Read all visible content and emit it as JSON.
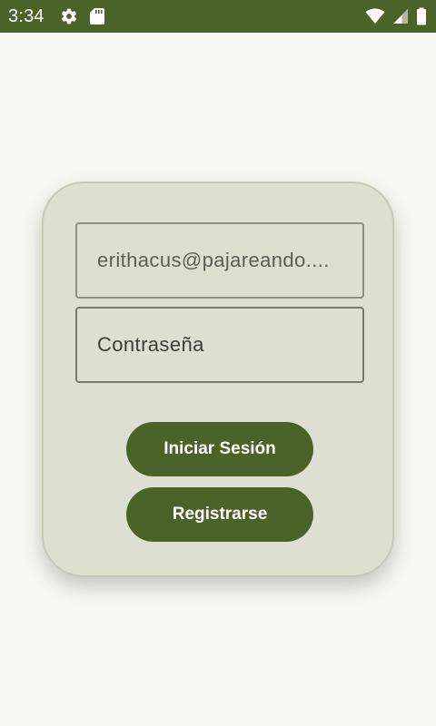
{
  "status_bar": {
    "time": "3:34",
    "bg_color": "#4b6329",
    "left_icons": [
      "gear-icon",
      "sd-card-icon"
    ],
    "right_icons": [
      "wifi-icon",
      "cell-signal-icon",
      "battery-icon"
    ]
  },
  "login_form": {
    "email": {
      "value": "erithacus@pajareando.com",
      "display": "erithacus@pajareando...."
    },
    "password": {
      "placeholder": "Contraseña"
    },
    "login_button_label": "Iniciar Sesión",
    "register_button_label": "Registrarse",
    "accent_color": "#4b6329",
    "card_color": "#dde0d1"
  }
}
